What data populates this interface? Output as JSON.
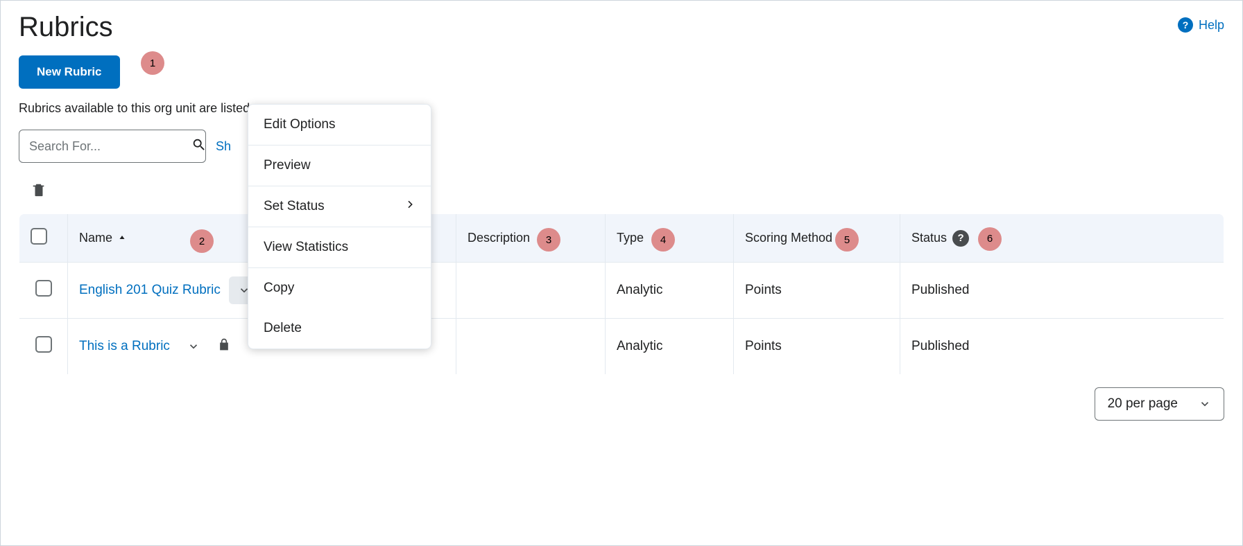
{
  "page_title": "Rubrics",
  "help_label": "Help",
  "new_rubric_label": "New Rubric",
  "description_text": "Rubrics available to this org unit are listed",
  "search": {
    "placeholder": "Search For..."
  },
  "show_text_partial": "Sh",
  "annotations": {
    "a1": "1",
    "a2": "2",
    "a3": "3",
    "a4": "4",
    "a5": "5",
    "a6": "6"
  },
  "dropdown": {
    "edit_options": "Edit Options",
    "preview": "Preview",
    "set_status": "Set Status",
    "view_statistics": "View Statistics",
    "copy": "Copy",
    "delete": "Delete"
  },
  "columns": {
    "name": "Name",
    "description": "Description",
    "type": "Type",
    "scoring_method": "Scoring Method",
    "status": "Status"
  },
  "rows": [
    {
      "name": "English 201 Quiz Rubric",
      "description": "",
      "type": "Analytic",
      "scoring": "Points",
      "status": "Published",
      "active": true
    },
    {
      "name": "This is a Rubric",
      "description": "",
      "type": "Analytic",
      "scoring": "Points",
      "status": "Published",
      "active": false
    }
  ],
  "pager_label": "20 per page"
}
